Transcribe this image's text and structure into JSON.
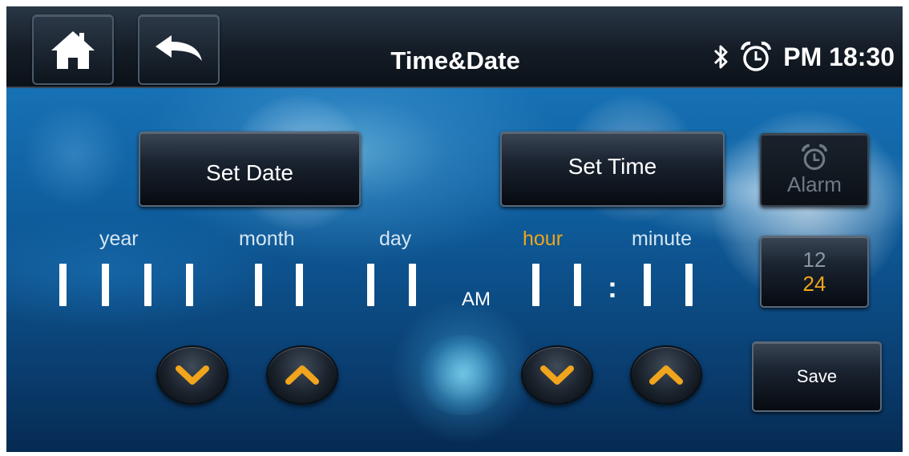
{
  "header": {
    "title": "Time&Date",
    "time_text": "PM 18:30",
    "home_icon": "home-icon",
    "back_icon": "back-arrow-icon",
    "bluetooth_icon": "bluetooth-icon",
    "alarm_icon": "alarm-clock-icon"
  },
  "buttons": {
    "set_date": "Set Date",
    "set_time": "Set Time",
    "alarm": "Alarm",
    "save": "Save"
  },
  "format": {
    "option_12": "12",
    "option_24": "24",
    "selected": "24"
  },
  "fields": {
    "year": "year",
    "month": "month",
    "day": "day",
    "hour": "hour",
    "minute": "minute",
    "active": "hour"
  },
  "ampm": "AM",
  "colors": {
    "accent": "#f0a51c",
    "header_bg": "#141c26",
    "label": "#d6e6f3"
  }
}
